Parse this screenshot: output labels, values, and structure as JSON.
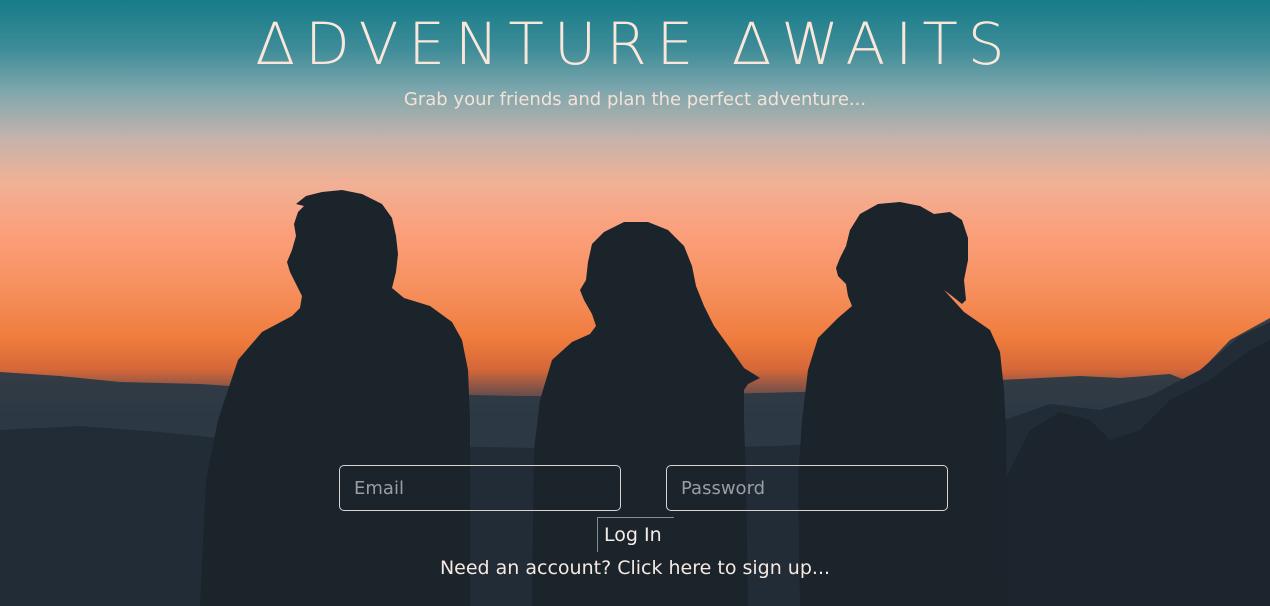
{
  "hero": {
    "title": "ΔDVENTURE ΔWAITS",
    "subtitle": "Grab your friends and plan the perfect adventure..."
  },
  "login_form": {
    "email_placeholder": "Email",
    "password_placeholder": "Password",
    "login_label": "Log In",
    "signup_text": "Need an account? Click here to sign up..."
  },
  "colors": {
    "sky_top": "#167c88",
    "sunset_orange": "#ef7c3d",
    "silhouette": "#1b232b",
    "text_light": "#fbe7da"
  }
}
